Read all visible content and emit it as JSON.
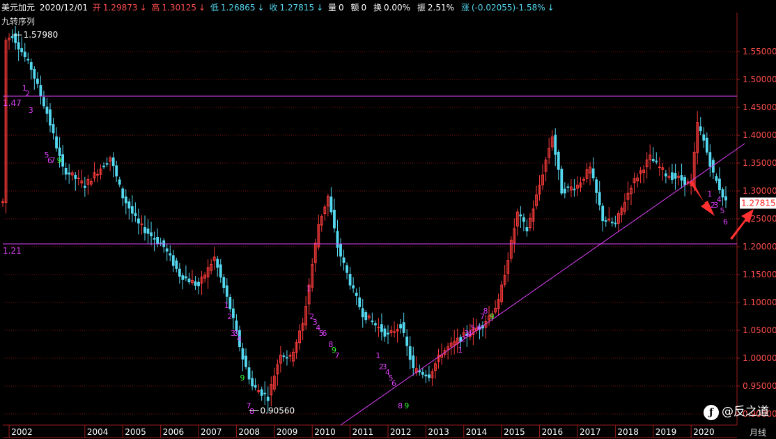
{
  "header": {
    "symbol": "美元加元",
    "date": "2020/12/01",
    "open_label": "开",
    "open": "1.29873",
    "high_label": "高",
    "high": "1.30125",
    "low_label": "低",
    "low": "1.26865",
    "close_label": "收",
    "close": "1.27815",
    "volume_label": "量",
    "volume": "0",
    "amount_label": "额",
    "amount": "0",
    "turnover_label": "换",
    "turnover": "0.00%",
    "amplitude_label": "振",
    "amplitude": "2.51%",
    "change_label": "涨",
    "change": "(-0.02055)-1.58%"
  },
  "indicator_name": "九转序列",
  "period_label": "月线",
  "watermark": "@反之道",
  "colors": {
    "up": "#ff3c3c",
    "down": "#54d8f0",
    "line": "#e040fb",
    "count": "#e040fb",
    "count9": "#33ff33",
    "grid": "#7a1010",
    "axis": "#9b1b1b"
  },
  "chart_data": {
    "type": "candlestick",
    "ylim": [
      0.88,
      1.62
    ],
    "y_ticks": [
      "1.55000",
      "1.50000",
      "1.45000",
      "1.40000",
      "1.35000",
      "1.30000",
      "1.25000",
      "1.20000",
      "1.15000",
      "1.10000",
      "1.05000",
      "1.00000",
      "0.95000",
      "0.90000"
    ],
    "x_ticks": [
      "2002",
      "2004",
      "2005",
      "2006",
      "2007",
      "2008",
      "2009",
      "2010",
      "2011",
      "2012",
      "2013",
      "2014",
      "2015",
      "2016",
      "2017",
      "2018",
      "2019",
      "2020"
    ],
    "high_marker": "1.57980",
    "low_marker": "0.90560",
    "last_price": "1.27815",
    "horizontal_lines": [
      {
        "label": "1.47",
        "value": 1.47
      },
      {
        "label": "1.21",
        "value": 1.205
      }
    ],
    "trendline": {
      "from": [
        "2010-10",
        0.88
      ],
      "to": [
        "2021-06",
        1.385
      ]
    },
    "anchors": [
      [
        "2001-12",
        1.57
      ],
      [
        "2002-02",
        1.58
      ],
      [
        "2002-08",
        1.52
      ],
      [
        "2003-01",
        1.44
      ],
      [
        "2003-06",
        1.34
      ],
      [
        "2004-01",
        1.31
      ],
      [
        "2004-09",
        1.36
      ],
      [
        "2005-01",
        1.29
      ],
      [
        "2005-06",
        1.24
      ],
      [
        "2006-02",
        1.2
      ],
      [
        "2006-07",
        1.15
      ],
      [
        "2007-01",
        1.13
      ],
      [
        "2007-06",
        1.18
      ],
      [
        "2007-11",
        1.09
      ],
      [
        "2008-03",
        1.0
      ],
      [
        "2008-06",
        0.95
      ],
      [
        "2008-11",
        0.93
      ],
      [
        "2009-03",
        1.01
      ],
      [
        "2009-06",
        1.0
      ],
      [
        "2009-10",
        1.06
      ],
      [
        "2010-03",
        1.24
      ],
      [
        "2010-06",
        1.29
      ],
      [
        "2010-09",
        1.2
      ],
      [
        "2011-02",
        1.12
      ],
      [
        "2011-05",
        1.08
      ],
      [
        "2012-01",
        1.04
      ],
      [
        "2012-05",
        1.06
      ],
      [
        "2012-09",
        0.98
      ],
      [
        "2013-02",
        0.97
      ],
      [
        "2013-06",
        1.01
      ],
      [
        "2014-01",
        1.04
      ],
      [
        "2014-07",
        1.06
      ],
      [
        "2014-12",
        1.1
      ],
      [
        "2015-06",
        1.26
      ],
      [
        "2015-09",
        1.23
      ],
      [
        "2016-01",
        1.31
      ],
      [
        "2016-05",
        1.4
      ],
      [
        "2016-08",
        1.3
      ],
      [
        "2017-01",
        1.31
      ],
      [
        "2017-05",
        1.34
      ],
      [
        "2017-09",
        1.25
      ],
      [
        "2018-01",
        1.24
      ],
      [
        "2018-06",
        1.31
      ],
      [
        "2018-12",
        1.36
      ],
      [
        "2019-05",
        1.33
      ],
      [
        "2019-10",
        1.32
      ],
      [
        "2020-01",
        1.31
      ],
      [
        "2020-03",
        1.42
      ],
      [
        "2020-05",
        1.39
      ],
      [
        "2020-08",
        1.33
      ],
      [
        "2020-12",
        1.28
      ]
    ],
    "td_counts": [
      [
        "2002-06",
        "1",
        1.48
      ],
      [
        "2002-07",
        "2",
        1.47
      ],
      [
        "2002-08",
        "3",
        1.44
      ],
      [
        "2003-01",
        "5",
        1.36
      ],
      [
        "2003-02",
        "6",
        1.35
      ],
      [
        "2003-03",
        "7",
        1.35
      ],
      [
        "2003-05",
        "9",
        1.35
      ],
      [
        "2007-10",
        "1",
        1.09
      ],
      [
        "2007-11",
        "2",
        1.07
      ],
      [
        "2007-12",
        "3",
        1.04
      ],
      [
        "2008-01",
        "3",
        1.04
      ],
      [
        "2008-02",
        "4",
        1.03
      ],
      [
        "2008-05",
        "7",
        0.91
      ],
      [
        "2008-06",
        "8",
        0.9
      ],
      [
        "2008-03",
        "9",
        0.96
      ],
      [
        "2009-12",
        "1",
        1.12
      ],
      [
        "2010-01",
        "2",
        1.07
      ],
      [
        "2010-02",
        "3",
        1.06
      ],
      [
        "2010-03",
        "4",
        1.05
      ],
      [
        "2010-04",
        "5",
        1.04
      ],
      [
        "2010-05",
        "6",
        1.04
      ],
      [
        "2010-07",
        "8",
        1.02
      ],
      [
        "2010-09",
        "7",
        1.0
      ],
      [
        "2010-08",
        "9",
        1.01
      ],
      [
        "2011-10",
        "1",
        1.0
      ],
      [
        "2011-11",
        "2",
        0.98
      ],
      [
        "2011-12",
        "3",
        0.98
      ],
      [
        "2012-01",
        "4",
        0.97
      ],
      [
        "2012-02",
        "5",
        0.96
      ],
      [
        "2012-03",
        "6",
        0.95
      ],
      [
        "2012-05",
        "8",
        0.91
      ],
      [
        "2012-07",
        "9",
        0.91
      ],
      [
        "2013-12",
        "1",
        1.01
      ],
      [
        "2014-01",
        "2",
        1.03
      ],
      [
        "2014-02",
        "3",
        1.04
      ],
      [
        "2014-03",
        "4",
        1.04
      ],
      [
        "2014-04",
        "5",
        1.05
      ],
      [
        "2014-06",
        "6",
        1.05
      ],
      [
        "2014-07",
        "7",
        1.07
      ],
      [
        "2014-08",
        "8",
        1.08
      ],
      [
        "2014-10",
        "9",
        1.07
      ],
      [
        "2020-07",
        "1",
        1.29
      ],
      [
        "2020-08",
        "2",
        1.27
      ],
      [
        "2020-09",
        "3",
        1.27
      ],
      [
        "2020-10",
        "4",
        1.28
      ],
      [
        "2020-11",
        "5",
        1.26
      ],
      [
        "2020-12",
        "6",
        1.24
      ]
    ]
  }
}
